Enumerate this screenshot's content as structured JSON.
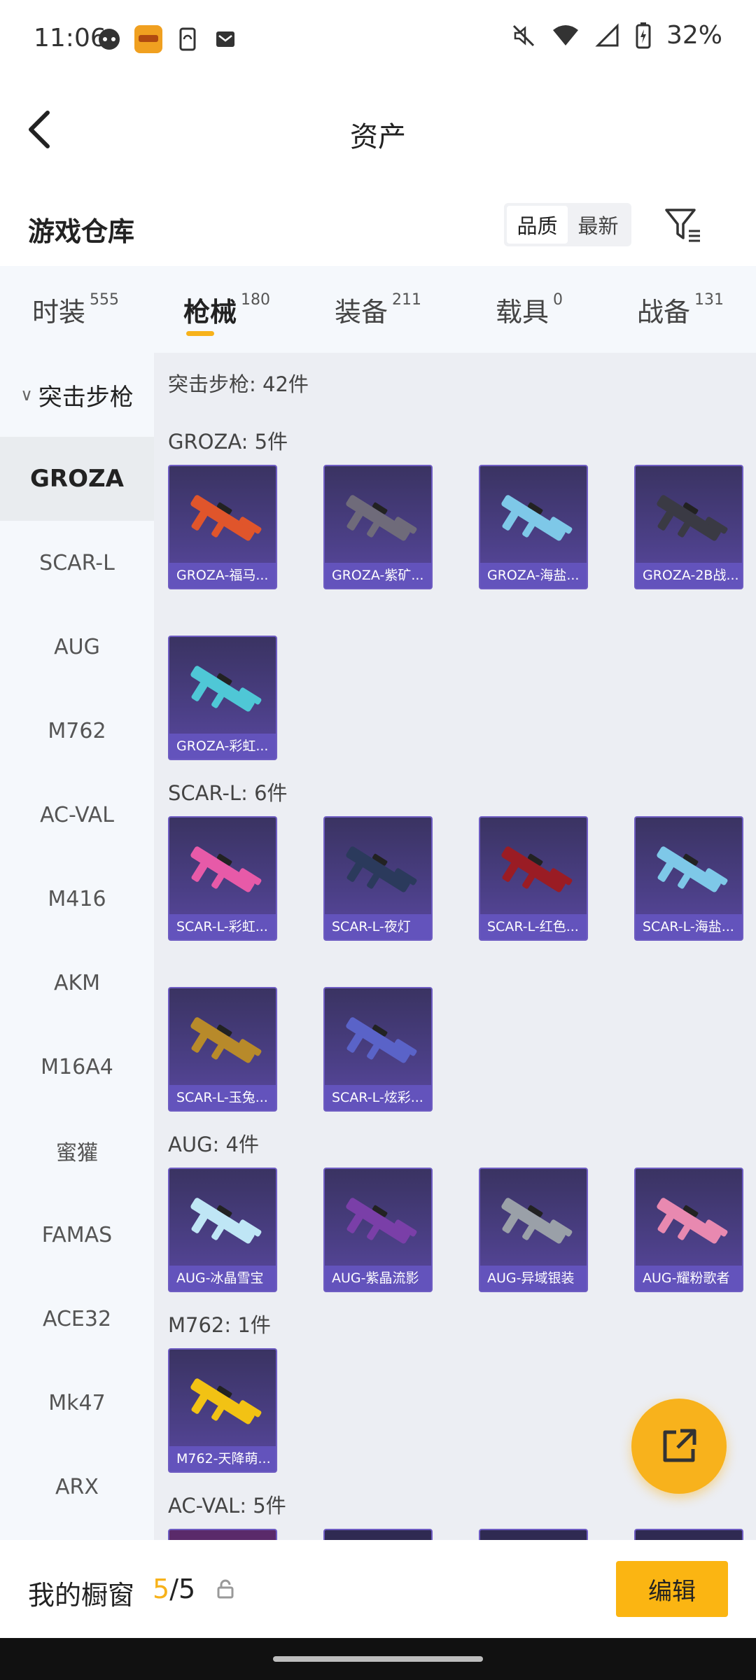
{
  "status_bar": {
    "time": "11:06",
    "battery": "32%",
    "icons": [
      "face-icon",
      "game-app-icon",
      "phone-sync-icon",
      "mail-icon",
      "mute-icon",
      "wifi-icon",
      "signal-icon",
      "battery-icon"
    ]
  },
  "header": {
    "title": "资产"
  },
  "warehouse": {
    "title": "游戏仓库",
    "sort_options": [
      "品质",
      "最新"
    ],
    "active_sort": "品质"
  },
  "tabs": [
    {
      "label": "时装",
      "count": "555"
    },
    {
      "label": "枪械",
      "count": "180",
      "active": true
    },
    {
      "label": "装备",
      "count": "211"
    },
    {
      "label": "载具",
      "count": "0"
    },
    {
      "label": "战备",
      "count": "131"
    }
  ],
  "sidebar": {
    "group": "突击步枪",
    "items": [
      "GROZA",
      "SCAR-L",
      "AUG",
      "M762",
      "AC-VAL",
      "M416",
      "AKM",
      "M16A4",
      "蜜獾",
      "FAMAS",
      "ACE32",
      "Mk47",
      "ARX"
    ],
    "active": "GROZA"
  },
  "content": {
    "category_header": "突击步枪: 42件",
    "sections": [
      {
        "title": "GROZA: 5件",
        "items": [
          "GROZA-福马...",
          "GROZA-紫矿...",
          "GROZA-海盐...",
          "GROZA-2B战...",
          "GROZA-彩虹..."
        ]
      },
      {
        "title": "SCAR-L: 6件",
        "items": [
          "SCAR-L-彩虹...",
          "SCAR-L-夜灯",
          "SCAR-L-红色...",
          "SCAR-L-海盐...",
          "SCAR-L-玉兔...",
          "SCAR-L-炫彩..."
        ]
      },
      {
        "title": "AUG: 4件",
        "items": [
          "AUG-冰晶雪宝",
          "AUG-紫晶流影",
          "AUG-异域银装",
          "AUG-耀粉歌者"
        ]
      },
      {
        "title": "M762: 1件",
        "items": [
          "M762-天降萌..."
        ]
      },
      {
        "title": "AC-VAL: 5件",
        "items": [
          "",
          "",
          "",
          ""
        ]
      }
    ],
    "gun_colors": {
      "groza": [
        "#e0552b",
        "#6f6b7a",
        "#7ec8e8",
        "#3a3a44",
        "#4fc7d6"
      ],
      "scar": [
        "#e75aa8",
        "#2b3a5c",
        "#9a1c24",
        "#7ec8e8",
        "#b88a2a",
        "#5a63c8"
      ],
      "aug": [
        "#bfe6f5",
        "#7a3fa8",
        "#9aa0a8",
        "#e889b0"
      ],
      "m762": [
        "#f2c214"
      ]
    }
  },
  "fab": {
    "icon": "share-external-icon"
  },
  "bottom_bar": {
    "label": "我的橱窗",
    "current": "5",
    "separator": "/",
    "total": "5",
    "lock_icon": "lock-icon",
    "edit_label": "编辑"
  }
}
